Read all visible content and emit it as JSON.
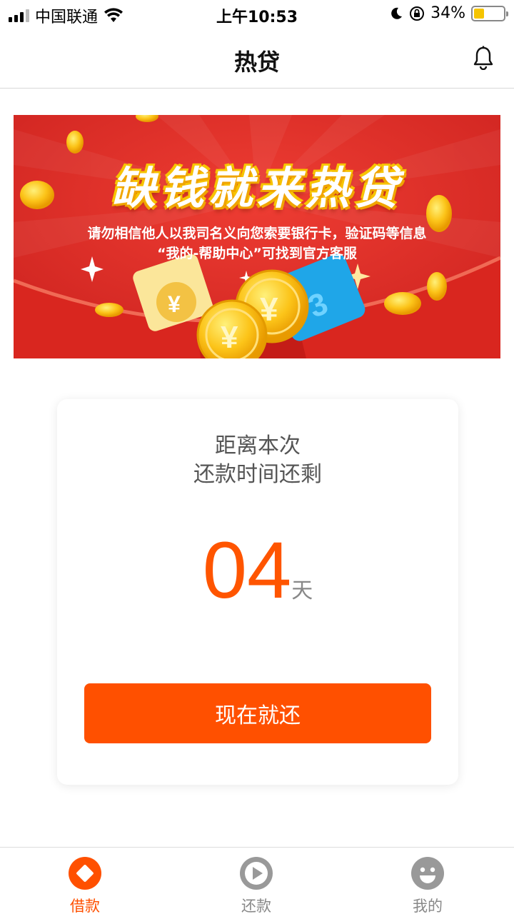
{
  "status_bar": {
    "carrier": "中国联通",
    "time": "上午10:53",
    "battery": "34%",
    "battery_level": 0.34
  },
  "header": {
    "title": "热贷"
  },
  "banner": {
    "title": "缺钱就来热贷",
    "notice_line1": "请勿相信他人以我司名义向您索要银行卡，验证码等信息",
    "notice_line2": "“我的-帮助中心”可找到官方客服"
  },
  "repayment_card": {
    "line1": "距离本次",
    "line2": "还款时间还剩",
    "days": "04",
    "days_unit": "天",
    "button_label": "现在就还",
    "accent_color": "#ff5000"
  },
  "tab_bar": {
    "items": [
      {
        "label": "借款",
        "icon": "loan-icon",
        "active": true
      },
      {
        "label": "还款",
        "icon": "play-icon",
        "active": false
      },
      {
        "label": "我的",
        "icon": "smiley-icon",
        "active": false
      }
    ]
  }
}
